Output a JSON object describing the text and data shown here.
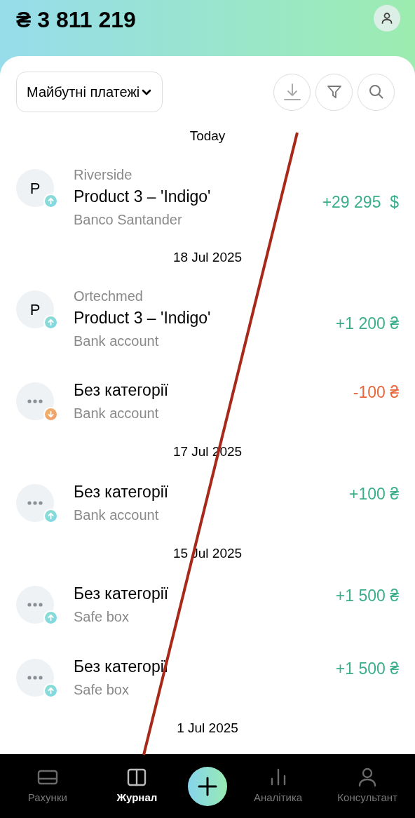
{
  "header": {
    "balance": "₴ 3 811 219"
  },
  "toolbar": {
    "filter_dropdown": "Майбутні платежі"
  },
  "groups": [
    {
      "date": "Today",
      "items": [
        {
          "kind": "letter",
          "letter": "P",
          "incoming": true,
          "counterparty": "Riverside",
          "title": "Product 3 – 'Indigo'",
          "account": "Banco Santander",
          "amount": "+29 295  $"
        }
      ]
    },
    {
      "date": "18 Jul 2025",
      "items": [
        {
          "kind": "letter",
          "letter": "P",
          "incoming": true,
          "counterparty": "Ortechmed",
          "title": "Product 3 – 'Indigo'",
          "account": "Bank account",
          "amount": "+1 200 ₴"
        },
        {
          "kind": "dots",
          "incoming": false,
          "title": "Без категорії",
          "account": "Bank account",
          "amount": "-100 ₴"
        }
      ]
    },
    {
      "date": "17 Jul 2025",
      "items": [
        {
          "kind": "dots",
          "incoming": true,
          "title": "Без категорії",
          "account": "Bank account",
          "amount": "+100 ₴"
        }
      ]
    },
    {
      "date": "15 Jul 2025",
      "items": [
        {
          "kind": "dots",
          "incoming": true,
          "title": "Без категорії",
          "account": "Safe box",
          "amount": "+1 500 ₴"
        },
        {
          "kind": "dots",
          "incoming": true,
          "title": "Без категорії",
          "account": "Safe box",
          "amount": "+1 500 ₴"
        }
      ]
    },
    {
      "date": "1 Jul 2025"
    }
  ],
  "nav": [
    {
      "kind": "accounts",
      "label": "Рахунки",
      "selected": false
    },
    {
      "kind": "journal",
      "label": "Журнал",
      "selected": true
    },
    {
      "kind": "add"
    },
    {
      "kind": "analytics",
      "label": "Аналітика",
      "selected": false
    },
    {
      "kind": "consultant",
      "label": "Консультант",
      "selected": false
    }
  ]
}
